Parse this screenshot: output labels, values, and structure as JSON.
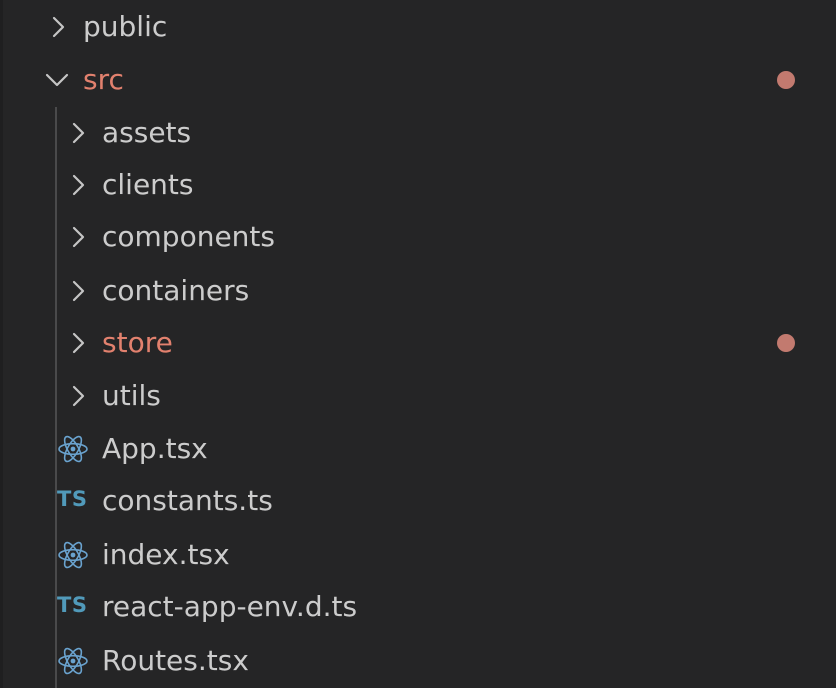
{
  "colors": {
    "background": "#252526",
    "text": "#cccccc",
    "modified": "#e2816e",
    "modified_dot": "#c27a6f",
    "react_icon": "#6aa3cf",
    "ts_icon": "#519aba",
    "chevron": "#c5c5c5"
  },
  "tree": {
    "public": {
      "name": "public",
      "type": "folder",
      "expanded": false,
      "icon": "chevron-right-icon"
    },
    "src": {
      "name": "src",
      "type": "folder",
      "expanded": true,
      "icon": "chevron-down-icon",
      "status": "modified",
      "children": {
        "assets": {
          "name": "assets",
          "type": "folder",
          "icon": "chevron-right-icon"
        },
        "clients": {
          "name": "clients",
          "type": "folder",
          "icon": "chevron-right-icon"
        },
        "components": {
          "name": "components",
          "type": "folder",
          "icon": "chevron-right-icon"
        },
        "containers": {
          "name": "containers",
          "type": "folder",
          "icon": "chevron-right-icon"
        },
        "store": {
          "name": "store",
          "type": "folder",
          "icon": "chevron-right-icon",
          "status": "modified"
        },
        "utils": {
          "name": "utils",
          "type": "folder",
          "icon": "chevron-right-icon"
        },
        "app": {
          "name": "App.tsx",
          "type": "file",
          "icon": "react-icon"
        },
        "constants": {
          "name": "constants.ts",
          "type": "file",
          "icon": "typescript-icon",
          "icon_text": "TS"
        },
        "index": {
          "name": "index.tsx",
          "type": "file",
          "icon": "react-icon"
        },
        "react_app_env": {
          "name": "react-app-env.d.ts",
          "type": "file",
          "icon": "typescript-icon",
          "icon_text": "TS"
        },
        "routes": {
          "name": "Routes.tsx",
          "type": "file",
          "icon": "react-icon"
        }
      }
    }
  }
}
